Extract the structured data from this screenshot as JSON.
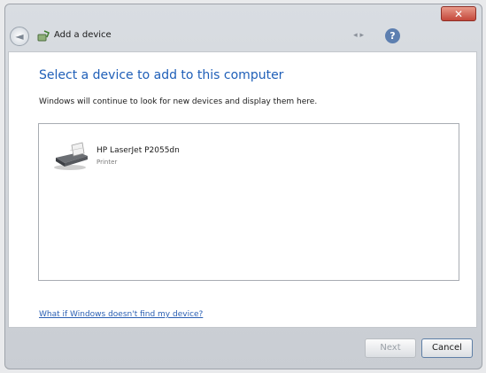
{
  "window": {
    "title": "Add a device",
    "close_label": "✕",
    "nav_aux": "◂ ▸"
  },
  "nav": {
    "back_glyph": "◄",
    "help_glyph": "?"
  },
  "main": {
    "heading": "Select a device to add to this computer",
    "subtext": "Windows will continue to look for new devices and display them here.",
    "devices": [
      {
        "name": "HP LaserJet P2055dn",
        "type": "Printer",
        "icon": "printer-icon"
      }
    ],
    "help_link": "What if Windows doesn't find my device?"
  },
  "footer": {
    "next_label": "Next",
    "cancel_label": "Cancel"
  },
  "colors": {
    "heading": "#1f5fb8",
    "link": "#2a5fb3",
    "close": "#c4473a"
  }
}
